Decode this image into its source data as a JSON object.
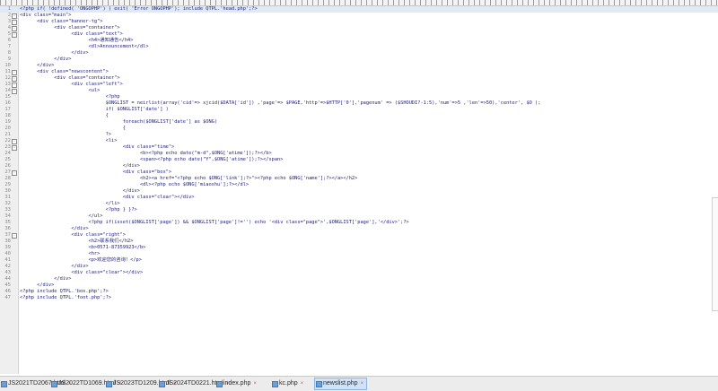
{
  "lines": [
    {
      "n": "1",
      "fold": "",
      "code": "<?php if( !defined( 'ONGOPHP') ) exit( 'Error ONGOPHP'); include QTPL.'head.php';?>"
    },
    {
      "n": "2",
      "fold": "⊟",
      "code": "<div class=\"main\">"
    },
    {
      "n": "3",
      "fold": "⊟",
      "code": "      <div class=\"banner-tg\">"
    },
    {
      "n": "4",
      "fold": "⊟",
      "code": "            <div class=\"container\">"
    },
    {
      "n": "5",
      "fold": "⊟",
      "code": "                  <div class=\"text\">"
    },
    {
      "n": "6",
      "fold": "",
      "code": "                        <h4>通知通告</h4>"
    },
    {
      "n": "7",
      "fold": "",
      "code": "                        <dl>Announcement</dl>"
    },
    {
      "n": "8",
      "fold": "",
      "code": "                  </div>"
    },
    {
      "n": "9",
      "fold": "",
      "code": "            </div>"
    },
    {
      "n": "10",
      "fold": "",
      "code": "      </div>"
    },
    {
      "n": "11",
      "fold": "⊟",
      "code": "      <div class=\"newscontent\">"
    },
    {
      "n": "12",
      "fold": "⊟",
      "code": "            <div class=\"container\">"
    },
    {
      "n": "13",
      "fold": "⊟",
      "code": "                  <div class=\"left\">"
    },
    {
      "n": "14",
      "fold": "⊟",
      "code": "                        <ul>"
    },
    {
      "n": "15",
      "fold": "",
      "code": "                              <?php"
    },
    {
      "n": "16",
      "fold": "",
      "code": "                              $ONGLIST = neirlist(array('cid'=> xjcid($DATA['id']) ,'page'=> $PAGE,'http'=>$HTTP['0'],'pagenum' => ($SHOUDI?-1:5),'num'=>5 ,'len'=>50),'center', $O );"
    },
    {
      "n": "17",
      "fold": "",
      "code": "                              if( $ONGLIST['date'] )"
    },
    {
      "n": "18",
      "fold": "",
      "code": "                              {"
    },
    {
      "n": "19",
      "fold": "",
      "code": "                                    foreach($ONGLIST['date'] as $ONG)"
    },
    {
      "n": "20",
      "fold": "",
      "code": "                                    {"
    },
    {
      "n": "21",
      "fold": "",
      "code": "                              ?>"
    },
    {
      "n": "22",
      "fold": "⊟",
      "code": "                              <li>"
    },
    {
      "n": "23",
      "fold": "⊟",
      "code": "                                    <div class=\"time\">"
    },
    {
      "n": "24",
      "fold": "",
      "code": "                                          <b><?php echo date(\"m-d\",$ONG['atime']);?></b>"
    },
    {
      "n": "25",
      "fold": "",
      "code": "                                          <span><?php echo date(\"Y\",$ONG['atime']);?></span>"
    },
    {
      "n": "26",
      "fold": "",
      "code": "                                    </div>"
    },
    {
      "n": "27",
      "fold": "⊟",
      "code": "                                    <div class=\"box\">"
    },
    {
      "n": "28",
      "fold": "",
      "code": "                                          <h2><a href=\"<?php echo $ONG['link'];?>\"><?php echo $ONG['name'];?></a></h2>"
    },
    {
      "n": "29",
      "fold": "",
      "code": "                                          <dl><?php echo $ONG['miaoshu'];?></dl>"
    },
    {
      "n": "30",
      "fold": "",
      "code": "                                    </div>"
    },
    {
      "n": "31",
      "fold": "",
      "code": "                                    <div class=\"clear\"></div>"
    },
    {
      "n": "32",
      "fold": "",
      "code": "                              </li>"
    },
    {
      "n": "33",
      "fold": "",
      "code": "                              <?php } }?>"
    },
    {
      "n": "34",
      "fold": "",
      "code": "                        </ul>"
    },
    {
      "n": "35",
      "fold": "",
      "code": "                        <?php if(isset($ONGLIST['page']) && $ONGLIST['page']!='') echo '<div class=\"page\">',$ONGLIST['page'],'</div>';?>"
    },
    {
      "n": "36",
      "fold": "",
      "code": "                  </div>"
    },
    {
      "n": "37",
      "fold": "⊟",
      "code": "                  <div class=\"right\">"
    },
    {
      "n": "38",
      "fold": "",
      "code": "                        <h2>联系我们</h2>"
    },
    {
      "n": "39",
      "fold": "",
      "code": "                        <b>0571-87359923</b>"
    },
    {
      "n": "40",
      "fold": "",
      "code": "                        <hr>"
    },
    {
      "n": "41",
      "fold": "",
      "code": "                        <p>欢迎您的咨询！</p>"
    },
    {
      "n": "42",
      "fold": "",
      "code": "                  </div>"
    },
    {
      "n": "43",
      "fold": "",
      "code": "                  <div class=\"clear\"></div>"
    },
    {
      "n": "44",
      "fold": "",
      "code": "            </div>"
    },
    {
      "n": "45",
      "fold": "",
      "code": "      </div>"
    },
    {
      "n": "46",
      "fold": "",
      "code": "<?php include QTPL.'box.php';?>"
    },
    {
      "n": "47",
      "fold": "",
      "code": "<?php include QTPL.'foot.php';?>"
    }
  ],
  "tabs": [
    {
      "label": "JS2021TD2067.html",
      "close": "×",
      "active": false
    },
    {
      "label": "JS2022TD1069.html",
      "close": "×",
      "active": false
    },
    {
      "label": "JS2023TD1209.html",
      "close": "×",
      "active": false
    },
    {
      "label": "JS2024TD0221.html",
      "close": "×",
      "active": false
    },
    {
      "label": "index.php",
      "close": "×",
      "active": false
    },
    {
      "label": "kc.php",
      "close": "×",
      "active": false
    },
    {
      "label": "newslist.php",
      "close": "×",
      "active": true
    }
  ]
}
